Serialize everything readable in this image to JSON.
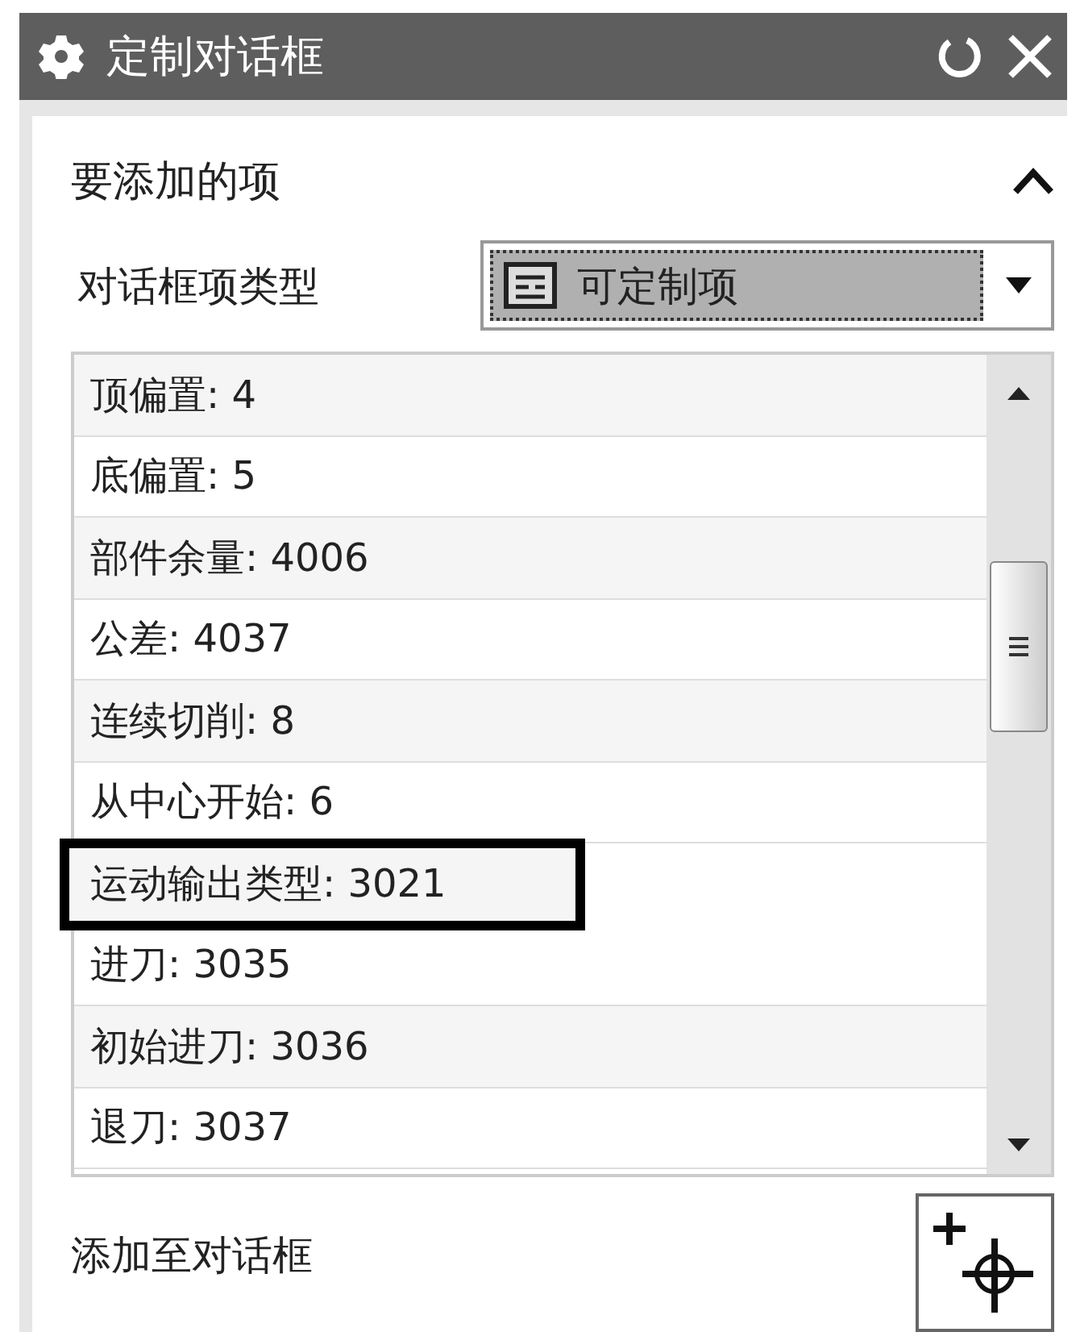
{
  "window": {
    "title": "定制对话框"
  },
  "section": {
    "title": "要添加的项",
    "expanded": true
  },
  "item_type": {
    "label": "对话框项类型",
    "value": "可定制项"
  },
  "items": [
    {
      "label": "顶偏置: 4",
      "highlighted": false
    },
    {
      "label": "底偏置: 5",
      "highlighted": false
    },
    {
      "label": "部件余量: 4006",
      "highlighted": false
    },
    {
      "label": "公差: 4037",
      "highlighted": false
    },
    {
      "label": "连续切削: 8",
      "highlighted": false
    },
    {
      "label": "从中心开始: 6",
      "highlighted": false
    },
    {
      "label": "运动输出类型: 3021",
      "highlighted": true
    },
    {
      "label": "进刀: 3035",
      "highlighted": false
    },
    {
      "label": "初始进刀: 3036",
      "highlighted": false
    },
    {
      "label": "退刀: 3037",
      "highlighted": false
    }
  ],
  "add": {
    "label": "添加至对话框"
  }
}
